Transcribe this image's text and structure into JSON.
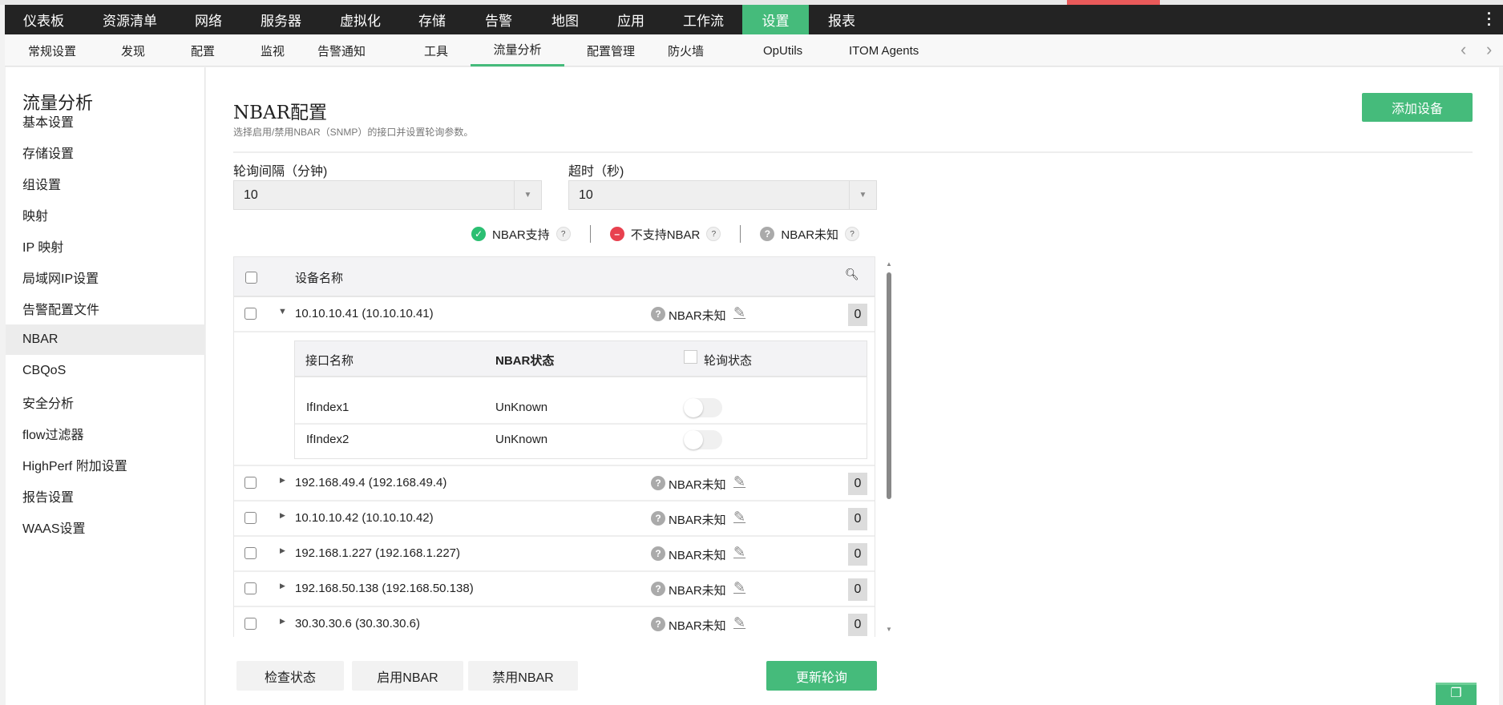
{
  "top_nav": [
    {
      "label": "仪表板"
    },
    {
      "label": "资源清单"
    },
    {
      "label": "网络"
    },
    {
      "label": "服务器"
    },
    {
      "label": "虚拟化"
    },
    {
      "label": "存储"
    },
    {
      "label": "告警"
    },
    {
      "label": "地图"
    },
    {
      "label": "应用"
    },
    {
      "label": "工作流"
    },
    {
      "label": "设置",
      "active": true
    },
    {
      "label": "报表"
    }
  ],
  "sub_nav": [
    {
      "label": "常规设置"
    },
    {
      "label": "发现"
    },
    {
      "label": "配置"
    },
    {
      "label": "监视"
    },
    {
      "label": "告警通知"
    },
    {
      "label": "工具"
    },
    {
      "label": "流量分析",
      "active": true
    },
    {
      "label": "配置管理"
    },
    {
      "label": "防火墙"
    },
    {
      "label": "OpUtils"
    },
    {
      "label": "ITOM Agents"
    }
  ],
  "sidebar": {
    "title": "流量分析",
    "items": [
      {
        "label": "基本设置"
      },
      {
        "label": "存储设置"
      },
      {
        "label": "组设置"
      },
      {
        "label": "映射"
      },
      {
        "label": "IP 映射"
      },
      {
        "label": "局域网IP设置"
      },
      {
        "label": "告警配置文件"
      },
      {
        "label": "NBAR",
        "active": true
      },
      {
        "label": "CBQoS"
      },
      {
        "label": "安全分析"
      },
      {
        "label": "flow过滤器"
      },
      {
        "label": "HighPerf 附加设置"
      },
      {
        "label": "报告设置"
      },
      {
        "label": "WAAS设置"
      }
    ]
  },
  "page": {
    "title": "NBAR配置",
    "subtitle": "选择启用/禁用NBAR（SNMP）的接口并设置轮询参数。",
    "add_device": "添加设备"
  },
  "form": {
    "poll_label": "轮询间隔（分钟)",
    "poll_value": "10",
    "timeout_label": "超时（秒)",
    "timeout_value": "10"
  },
  "legend": {
    "supported": "NBAR支持",
    "unsupported": "不支持NBAR",
    "unknown": "NBAR未知",
    "help": "?"
  },
  "colors": {
    "accent": "#45bb7b",
    "supported": "#2bbf72",
    "unsupported": "#e8414f",
    "unknown": "#aaaaaa"
  },
  "table": {
    "header": "设备名称",
    "devices": [
      {
        "name": "10.10.10.41 (10.10.10.41)",
        "status": "NBAR未知",
        "count": "0",
        "expanded": true
      },
      {
        "name": "192.168.49.4 (192.168.49.4)",
        "status": "NBAR未知",
        "count": "0"
      },
      {
        "name": "10.10.10.42 (10.10.10.42)",
        "status": "NBAR未知",
        "count": "0"
      },
      {
        "name": "192.168.1.227 (192.168.1.227)",
        "status": "NBAR未知",
        "count": "0"
      },
      {
        "name": "192.168.50.138 (192.168.50.138)",
        "status": "NBAR未知",
        "count": "0"
      },
      {
        "name": "30.30.30.6 (30.30.30.6)",
        "status": "NBAR未知",
        "count": "0"
      }
    ],
    "sub_headers": {
      "interface": "接口名称",
      "nbar_status": "NBAR状态",
      "poll_status": "轮询状态"
    },
    "interfaces": [
      {
        "name": "IfIndex1",
        "status": "UnKnown",
        "polling": false
      },
      {
        "name": "IfIndex2",
        "status": "UnKnown",
        "polling": false
      }
    ]
  },
  "buttons": {
    "check": "检查状态",
    "enable": "启用NBAR",
    "disable": "禁用NBAR",
    "update": "更新轮询"
  }
}
